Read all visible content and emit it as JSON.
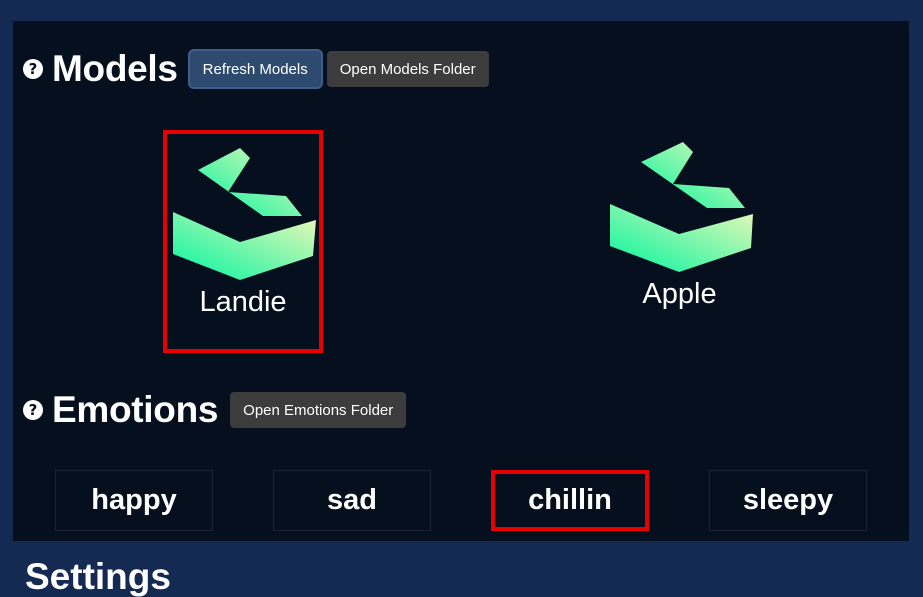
{
  "models_section": {
    "title": "Models",
    "refresh_label": "Refresh Models",
    "open_folder_label": "Open Models Folder",
    "help_icon": "?",
    "items": [
      {
        "name": "Landie",
        "icon": "logo-icon",
        "selected": true
      },
      {
        "name": "Apple",
        "icon": "logo-icon",
        "selected": false
      }
    ]
  },
  "emotions_section": {
    "title": "Emotions",
    "open_folder_label": "Open Emotions Folder",
    "help_icon": "?",
    "items": [
      {
        "label": "happy",
        "selected": false
      },
      {
        "label": "sad",
        "selected": false
      },
      {
        "label": "chillin",
        "selected": true
      },
      {
        "label": "sleepy",
        "selected": false
      }
    ]
  },
  "settings_section": {
    "title": "Settings"
  },
  "colors": {
    "page_bg": "#142a52",
    "panel_bg": "#050f1e",
    "selection": "#e60000",
    "logo_green": "#00f5a0",
    "logo_yellow": "#f0f8b8"
  }
}
